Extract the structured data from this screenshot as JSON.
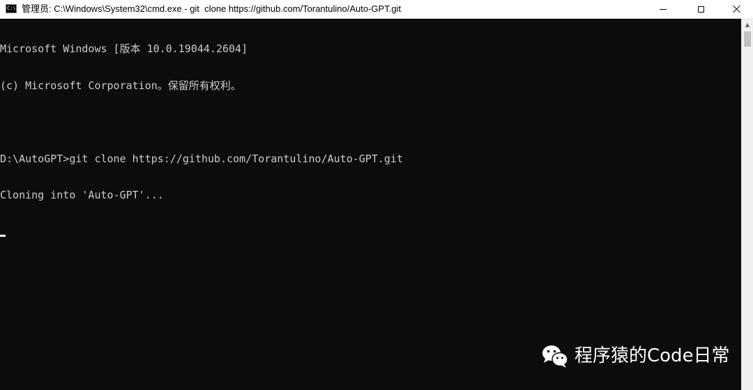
{
  "window": {
    "title": "管理员: C:\\Windows\\System32\\cmd.exe - git  clone https://github.com/Torantulino/Auto-GPT.git",
    "icon": "cmd-icon",
    "icon_text": "C:\\",
    "controls": {
      "minimize_icon": "minimize-icon",
      "maximize_icon": "maximize-icon",
      "close_icon": "close-icon"
    }
  },
  "console": {
    "lines": [
      "Microsoft Windows [版本 10.0.19044.2604]",
      "(c) Microsoft Corporation。保留所有权利。",
      "",
      "D:\\AutoGPT>git clone https://github.com/Torantulino/Auto-GPT.git",
      "Cloning into 'Auto-GPT'..."
    ],
    "text_color": "#cccccc",
    "background_color": "#0c0c0c"
  },
  "scrollbar": {
    "up_arrow_icon": "chevron-up-icon"
  },
  "watermark": {
    "logo_icon": "wechat-icon",
    "text": "程序猿的Code日常"
  }
}
